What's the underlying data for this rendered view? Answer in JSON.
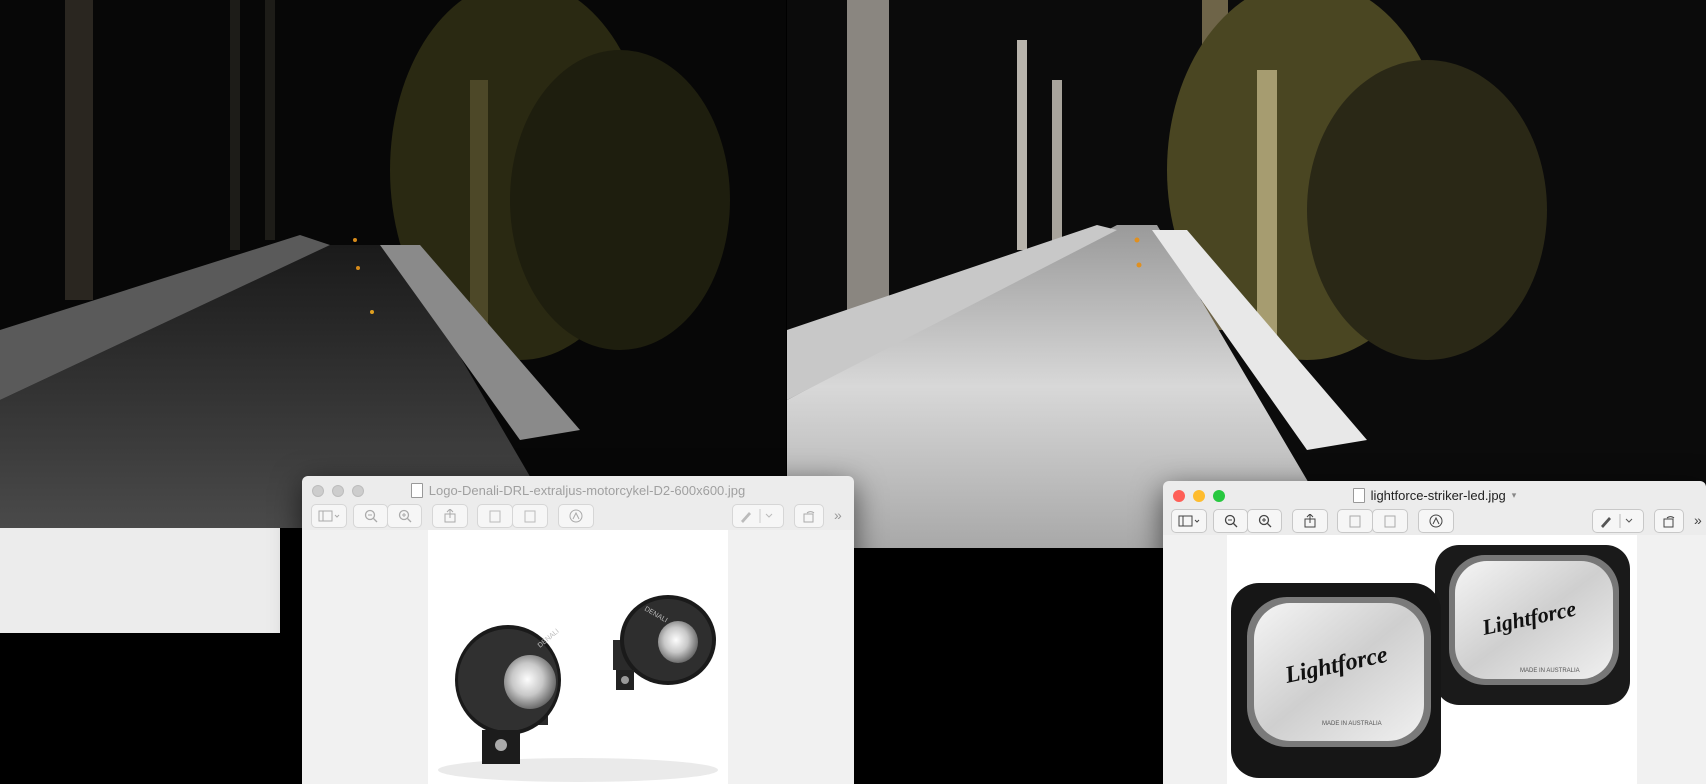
{
  "windows": [
    {
      "title": "Logo-Denali-DRL-extraljus-motorcykel-D2-600x600.jpg",
      "state": "inactive",
      "image_subject": "two round black auxiliary LED lights with DENALI branding"
    },
    {
      "title": "lightforce-striker-led.jpg",
      "state": "active",
      "image_subject": "two rectangular black LED driving lights with Lightforce branding"
    }
  ],
  "product_labels": {
    "denali_brand": "DENALI",
    "lightforce_brand": "Lightforce",
    "made_in": "MADE IN AUSTRALIA"
  },
  "toolbar_icons": [
    "sidebar-icon",
    "zoom-out-icon",
    "zoom-in-icon",
    "share-icon",
    "rotate-left-icon",
    "rotate-right-icon",
    "markup-icon",
    "pen-icon",
    "rotate-icon",
    "overflow-icon"
  ],
  "colors": {
    "close": "#fe5f57",
    "minimize": "#febc2e",
    "zoom": "#28c840",
    "window_bg": "#ececec"
  }
}
